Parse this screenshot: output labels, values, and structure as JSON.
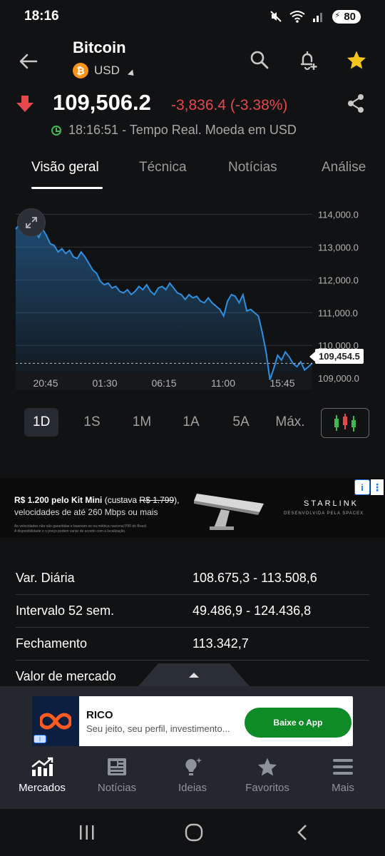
{
  "status_bar": {
    "time": "18:16",
    "battery": "80"
  },
  "header": {
    "title": "Bitcoin",
    "currency": "USD",
    "btc_symbol": "₿"
  },
  "quote": {
    "price": "109,506.2",
    "change": "-3,836.4 (-3.38%)",
    "realtime_text": "18:16:51 - Tempo Real. Moeda em USD",
    "change_color": "#e5484d"
  },
  "tabs": [
    {
      "label": "Visão geral",
      "active": true
    },
    {
      "label": "Técnica",
      "active": false
    },
    {
      "label": "Notícias",
      "active": false
    },
    {
      "label": "Análise",
      "active": false
    }
  ],
  "chart_data": {
    "type": "area",
    "y_ticks": [
      "114,000.0",
      "113,000.0",
      "112,000.0",
      "111,000.0",
      "110,000.0",
      "109,000.0"
    ],
    "x_ticks": [
      "20:45",
      "01:30",
      "06:15",
      "11:00",
      "15:45"
    ],
    "ylim": [
      108700,
      114400
    ],
    "last_price_label": "109,454.5",
    "last_price": 109454.5,
    "line_color": "#2f8fe0",
    "values": [
      113550,
      113700,
      113500,
      113600,
      113450,
      113500,
      113300,
      113550,
      113350,
      113100,
      113050,
      112850,
      112950,
      112800,
      112900,
      112700,
      112650,
      112850,
      112700,
      112500,
      112300,
      112200,
      111950,
      111850,
      111900,
      111750,
      111800,
      111650,
      111600,
      111700,
      111550,
      111650,
      111800,
      111700,
      111850,
      111650,
      111550,
      111750,
      111800,
      111700,
      111900,
      111750,
      111600,
      111550,
      111400,
      111550,
      111450,
      111500,
      111350,
      111300,
      111450,
      111300,
      111200,
      111100,
      110900,
      111350,
      111550,
      111500,
      111300,
      111550,
      111050,
      111100,
      111000,
      110900,
      110400,
      109800,
      108950,
      109300,
      109700,
      109550,
      109800,
      109650,
      109450,
      109350,
      109500,
      109250,
      109350,
      109454.5
    ]
  },
  "ranges": [
    {
      "label": "1D",
      "active": true
    },
    {
      "label": "1S",
      "active": false
    },
    {
      "label": "1M",
      "active": false
    },
    {
      "label": "1A",
      "active": false
    },
    {
      "label": "5A",
      "active": false
    },
    {
      "label": "Máx.",
      "active": false
    }
  ],
  "ad_banner": {
    "line1_prefix": "R$ 1.200 pelo Kit Mini",
    "line1_middle": " (custava ",
    "line1_strike": "R$ 1.799",
    "line1_end": "),",
    "line2": "velocidades de até 260 Mbps ou mais",
    "fine_print_1": "As velocidades não são garantidas e baseiam-se na métrica nacional P90 do Brasil.",
    "fine_print_2": "A disponibilidade e o preço podem variar de acordo com a localização.",
    "brand": "STARLINK",
    "sub": "DESENVOLVIDA PELA SPACEX"
  },
  "stats": [
    {
      "label": "Var. Diária",
      "value": "108.675,3 - 113.508,6"
    },
    {
      "label": "Intervalo 52 sem.",
      "value": "49.486,9 - 124.436,8"
    },
    {
      "label": "Fechamento",
      "value": "113.342,7"
    },
    {
      "label": "Valor de mercado",
      "value": ""
    }
  ],
  "rico_ad": {
    "name": "RICO",
    "desc": "Seu jeito, seu perfil, investimento...",
    "button": "Baixe o App"
  },
  "nav": [
    {
      "label": "Mercados",
      "icon": "markets-chart-icon",
      "active": true
    },
    {
      "label": "Notícias",
      "icon": "newspaper-icon",
      "active": false
    },
    {
      "label": "Ideias",
      "icon": "lightbulb-icon",
      "active": false
    },
    {
      "label": "Favoritos",
      "icon": "star-icon",
      "active": false
    },
    {
      "label": "Mais",
      "icon": "hamburger-menu-icon",
      "active": false
    }
  ]
}
